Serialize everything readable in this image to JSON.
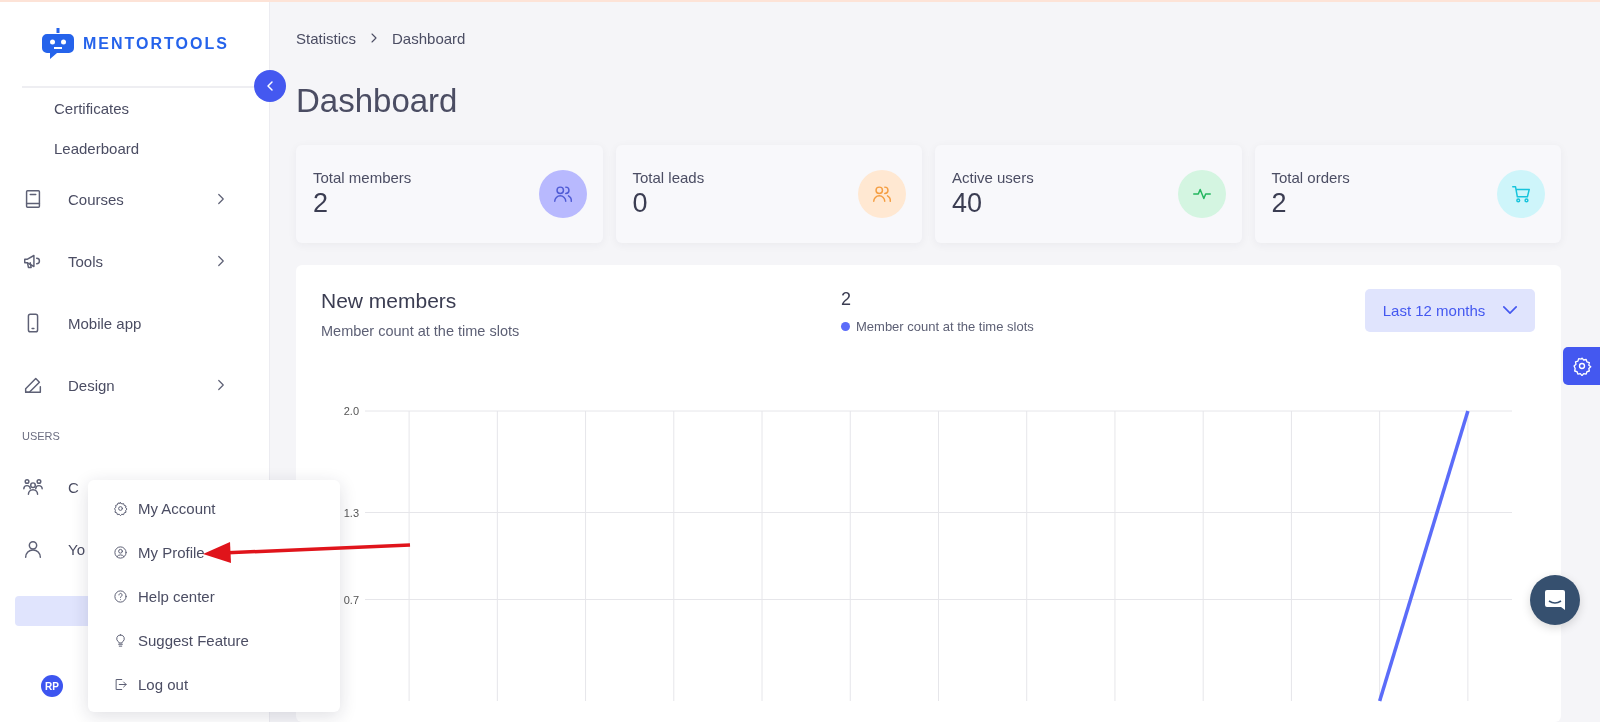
{
  "brand": {
    "name": "MENTORTOOLS"
  },
  "sidebar": {
    "items": [
      {
        "kind": "subitem",
        "label": "Certificates"
      },
      {
        "kind": "subitem",
        "label": "Leaderboard"
      },
      {
        "kind": "item",
        "label": "Courses",
        "has_submenu": true,
        "selected": false
      },
      {
        "kind": "item",
        "label": "Tools",
        "has_submenu": true,
        "selected": false
      },
      {
        "kind": "item",
        "label": "Mobile app",
        "has_submenu": false,
        "selected": false
      },
      {
        "kind": "item",
        "label": "Design",
        "has_submenu": true,
        "selected": false
      },
      {
        "kind": "section",
        "label": "USERS"
      },
      {
        "kind": "item",
        "label": "C",
        "selected": false
      },
      {
        "kind": "item",
        "label": "Yo",
        "selected": false
      },
      {
        "kind": "item",
        "selected": true
      }
    ],
    "user": {
      "initials": "RP"
    }
  },
  "breadcrumb": [
    "Statistics",
    "Dashboard"
  ],
  "page_title": "Dashboard",
  "stats": [
    {
      "label": "Total members",
      "value": "2",
      "color": "#b8b9fe"
    },
    {
      "label": "Total leads",
      "value": "0",
      "color": "#ffe8d2"
    },
    {
      "label": "Active users",
      "value": "40",
      "color": "#d4f5e1"
    },
    {
      "label": "Total orders",
      "value": "2",
      "color": "#cef5fa"
    }
  ],
  "chart_card": {
    "title": "New members",
    "subtitle": "Member count at the time slots",
    "total": "2",
    "range": "Last 12 months",
    "chart_data": {
      "type": "line",
      "series": [
        {
          "name": "Member count at the time slots",
          "color": "#5b6cf9",
          "values": [
            null,
            null,
            null,
            null,
            null,
            null,
            null,
            null,
            null,
            null,
            null,
            0,
            2
          ]
        }
      ],
      "grid": true,
      "ylim": [
        0,
        2
      ],
      "yticks": [
        {
          "value": 2,
          "label": "2.0"
        },
        {
          "value": 1.3,
          "label": "1.3"
        },
        {
          "value": 0.7,
          "label": "0.7"
        }
      ]
    }
  },
  "user_menu": {
    "items": [
      {
        "label": "My Account"
      },
      {
        "label": "My Profile"
      },
      {
        "label": "Help center"
      },
      {
        "label": "Suggest Feature"
      },
      {
        "label": "Log out"
      }
    ]
  }
}
